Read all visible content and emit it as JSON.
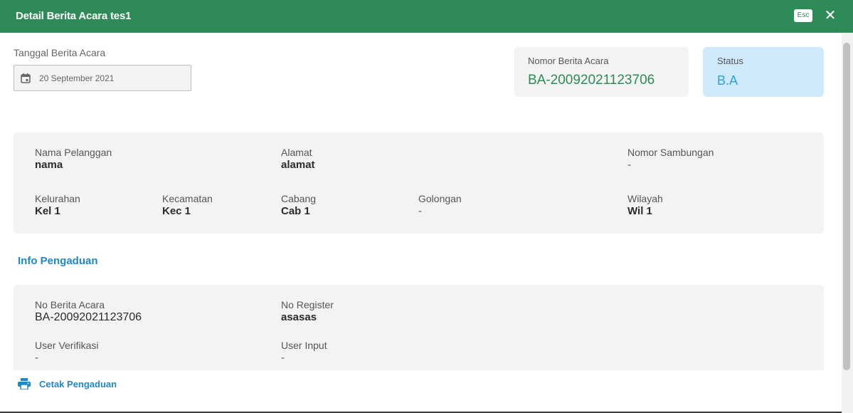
{
  "header": {
    "title": "Detail Berita Acara tes1",
    "esc_label": "Esc",
    "close_glyph": "✕"
  },
  "date": {
    "label": "Tanggal Berita Acara",
    "value": "20 September 2021",
    "icon": "calendar-icon"
  },
  "nomor": {
    "label": "Nomor Berita Acara",
    "value": "BA-20092021123706"
  },
  "status": {
    "label": "Status",
    "value": "B.A"
  },
  "customer": {
    "nama_label": "Nama Pelanggan",
    "nama_value": "nama",
    "alamat_label": "Alamat",
    "alamat_value": "alamat",
    "sambungan_label": "Nomor Sambungan",
    "sambungan_value": "-",
    "kelurahan_label": "Kelurahan",
    "kelurahan_value": "Kel 1",
    "kecamatan_label": "Kecamatan",
    "kecamatan_value": "Kec 1",
    "cabang_label": "Cabang",
    "cabang_value": "Cab 1",
    "golongan_label": "Golongan",
    "golongan_value": "-",
    "wilayah_label": "Wilayah",
    "wilayah_value": "Wil 1"
  },
  "info": {
    "section_title": "Info Pengaduan",
    "no_ba_label": "No Berita Acara",
    "no_ba_value": "BA-20092021123706",
    "no_register_label": "No Register",
    "no_register_value": "asasas",
    "user_verifikasi_label": "User Verifikasi",
    "user_verifikasi_value": "-",
    "user_input_label": "User Input",
    "user_input_value": "-"
  },
  "actions": {
    "print_label": "Cetak Pengaduan",
    "print_icon": "printer-icon"
  },
  "colors": {
    "header": "#2e8b57",
    "accent_blue": "#1e88c8",
    "status_bg": "#cfeafd",
    "panel_bg": "#f3f3f3"
  }
}
